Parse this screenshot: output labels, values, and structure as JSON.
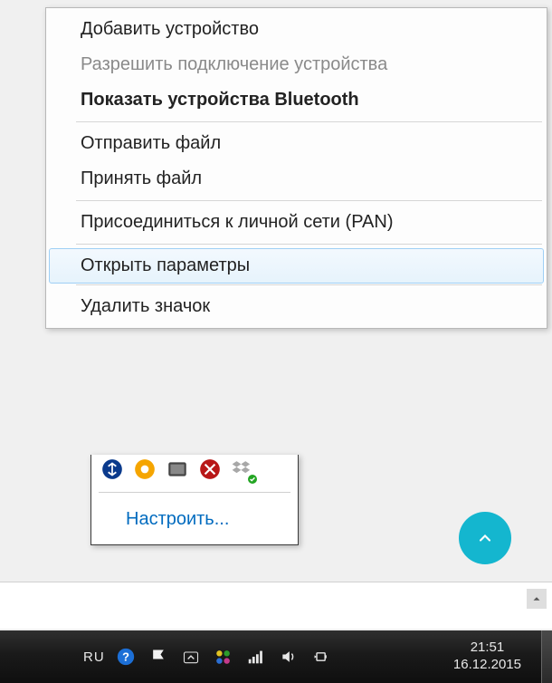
{
  "menu": {
    "add_device": "Добавить устройство",
    "allow_connection": "Разрешить подключение устройства",
    "show_devices": "Показать устройства Bluetooth",
    "send_file": "Отправить файл",
    "receive_file": "Принять файл",
    "join_pan": "Присоединиться к личной сети (PAN)",
    "open_settings": "Открыть параметры",
    "remove_icon": "Удалить значок"
  },
  "tray_popup": {
    "customize": "Настроить..."
  },
  "taskbar": {
    "lang": "RU",
    "time": "21:51",
    "date": "16.12.2015"
  },
  "icons": {
    "help": "help-icon",
    "flag": "action-center-icon",
    "tray_up": "tray-overflow-icon",
    "network_home": "homegroup-icon",
    "signal": "wifi-icon",
    "volume": "volume-icon",
    "power": "power-icon"
  }
}
